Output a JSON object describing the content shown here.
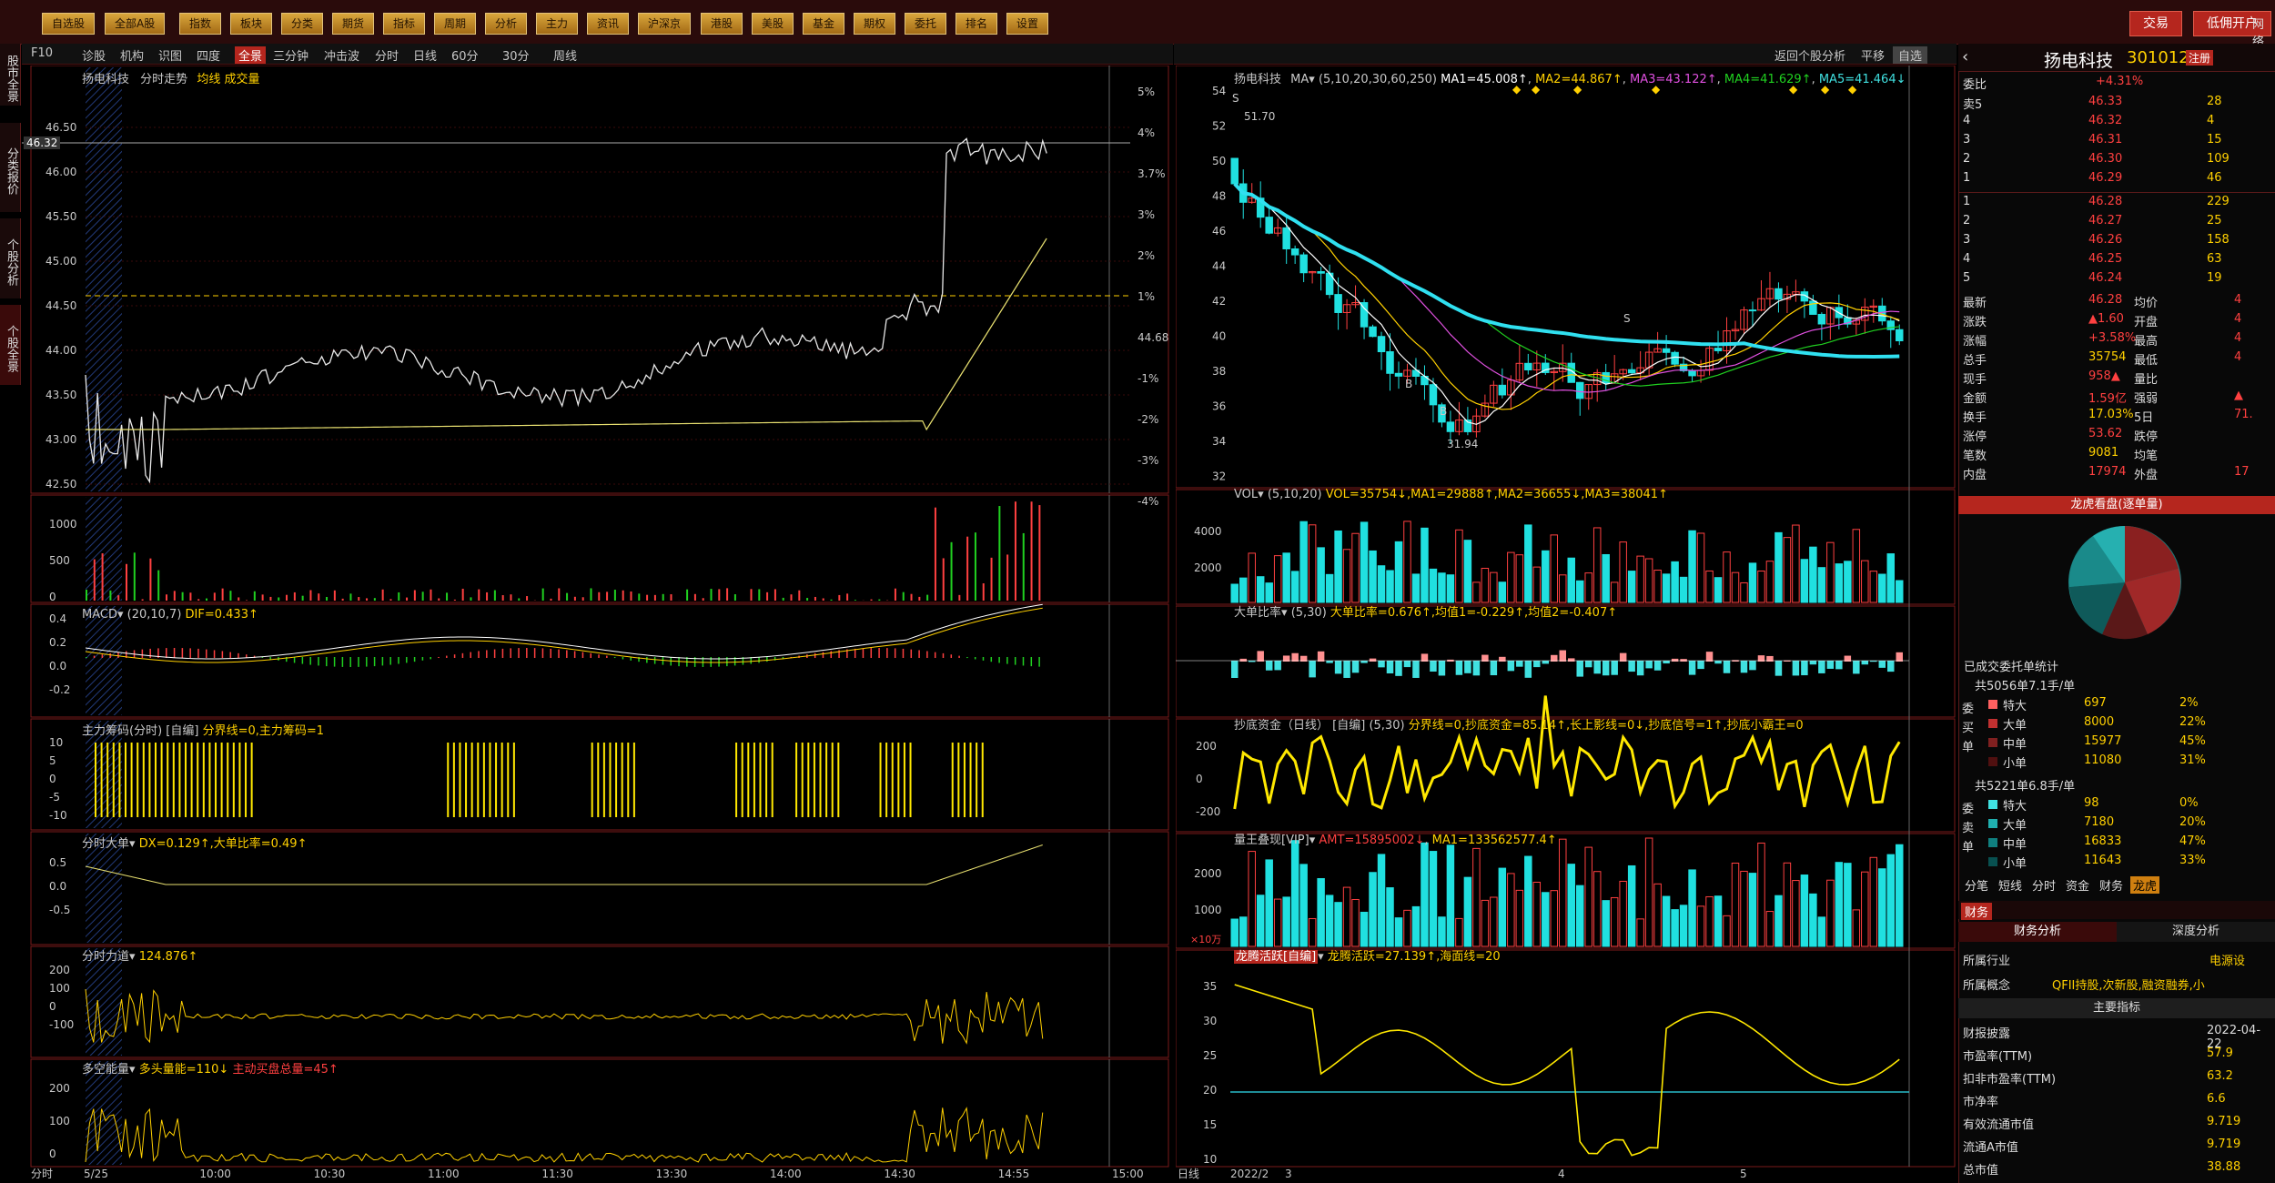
{
  "topbar": {
    "nav_buttons": [
      "自选股",
      "全部A股",
      "指数",
      "板块",
      "分类",
      "期货",
      "指标",
      "周期",
      "分析",
      "主力",
      "资讯",
      "沪深京",
      "港股",
      "美股",
      "基金",
      "期权",
      "委托",
      "排名",
      "设置"
    ],
    "trade_label": "交易",
    "open_account_label": "低佣开户",
    "network_label": "网络"
  },
  "sidetabs": [
    "股市全景",
    "分类报价",
    "个股分析",
    "个股全景"
  ],
  "left_toolbar": {
    "items": [
      "F10",
      "诊股",
      "机构",
      "识图",
      "四度",
      "全景",
      "三分钟",
      "冲击波",
      "分时",
      "日线",
      "60分",
      "30分",
      "周线"
    ],
    "active": "全景"
  },
  "mid_toolbar": {
    "back_label": "返回个股分析",
    "flat_label": "平移",
    "select_label": "自选"
  },
  "intraday": {
    "stock_name": "扬电科技",
    "mode": "分时走势",
    "legend": "均线 成交量",
    "y_ticks": [
      "46.50",
      "46.00",
      "45.50",
      "45.00",
      "44.50",
      "44.00",
      "43.50",
      "43.00",
      "42.50"
    ],
    "current_price": "46.32",
    "pct_ticks": [
      "5%",
      "4%",
      "3.7%",
      "3%",
      "2%",
      "1%",
      "44.68",
      "-1%",
      "-2%",
      "-3%",
      "-4%"
    ],
    "time_ticks": [
      "分时",
      "5/25",
      "10:00",
      "10:30",
      "11:00",
      "11:30",
      "13:30",
      "14:00",
      "14:30",
      "14:55",
      "15:00"
    ]
  },
  "subpanels": {
    "volume": {
      "y_ticks": [
        "1000",
        "500",
        "0"
      ]
    },
    "macd": {
      "title": "MACD",
      "params": "(20,10,7)",
      "value": "DIF=0.433↑",
      "y_ticks": [
        "0.4",
        "0.2",
        "0.0",
        "-0.2"
      ]
    },
    "main_chip": {
      "title": "主力筹码(分时)",
      "mode": "[自编]",
      "params": "分界线=0,主力筹码=1",
      "y_ticks": [
        "10",
        "5",
        "0",
        "-5",
        "-10"
      ]
    },
    "big_order": {
      "title": "分时大单",
      "value": "DX=0.129↑,大单比率=0.49↑",
      "y_ticks": [
        "0.5",
        "0.0",
        "-0.5"
      ]
    },
    "force": {
      "title": "分时力道",
      "value": "124.876↑",
      "y_ticks": [
        "200",
        "100",
        "0",
        "-100"
      ]
    },
    "multi_energy": {
      "title": "多空能量",
      "value1": "多头量能=110↓",
      "value2": "主动买盘总量=45↑",
      "y_ticks": [
        "200",
        "100",
        "0"
      ]
    }
  },
  "kline": {
    "stock_name": "扬电科技",
    "indicator": "MA",
    "params": "(5,10,20,30,60,250)",
    "ma1": "MA1=45.008↑",
    "ma2": "MA2=44.867↑",
    "ma3": "MA3=43.122↑",
    "ma4": "MA4=41.629↑",
    "ma5": "MA5=41.464↓",
    "y_ticks": [
      "54",
      "52",
      "50",
      "48",
      "46",
      "44",
      "42",
      "40",
      "38",
      "36",
      "34",
      "32"
    ],
    "high_label": "51.70",
    "low_label": "31.94",
    "signal_s": "S",
    "signal_b": "B",
    "date_ticks": [
      "日线",
      "2022/2",
      "3",
      "4",
      "5"
    ]
  },
  "kline_sub": {
    "vol": {
      "title": "VOL",
      "params": "(5,10,20)",
      "values": "VOL=35754↓,MA1=29888↑,MA2=36655↓,MA3=38041↑",
      "y_ticks": [
        "4000",
        "2000"
      ]
    },
    "big_ratio": {
      "title": "大单比率",
      "params": "(5,30)",
      "values": "大单比率=0.676↑,均值1=-0.229↑,均值2=-0.407↑"
    },
    "bottom_fund": {
      "title": "抄底资金（日线）",
      "mode": "[自编]",
      "params": "(5,30)",
      "values": "分界线=0,抄底资金=85.14↑,长上影线=0↓,抄底信号=1↑,抄底小霸王=0",
      "y_ticks": [
        "200",
        "0",
        "-200"
      ]
    },
    "volume_king": {
      "title": "量王叠现[VIP]",
      "values1": "AMT=15895002↓",
      "values2": "MA1=133562577.4↑",
      "y_ticks": [
        "2000",
        "1000"
      ],
      "unit": "×10万"
    },
    "dragon": {
      "title": "龙腾活跃[自编]",
      "values": "龙腾活跃=27.139↑,海面线=20",
      "y_ticks": [
        "35",
        "30",
        "25",
        "20",
        "15",
        "10"
      ]
    }
  },
  "right_panel": {
    "stock_name": "扬电科技",
    "code": "301012",
    "tag": "注册",
    "committee_ratio_label": "委比",
    "committee_ratio_value": "+4.31%",
    "asks": [
      {
        "label": "卖5",
        "price": "46.33",
        "vol": "28"
      },
      {
        "label": "4",
        "price": "46.32",
        "vol": "4"
      },
      {
        "label": "3",
        "price": "46.31",
        "vol": "15"
      },
      {
        "label": "2",
        "price": "46.30",
        "vol": "109"
      },
      {
        "label": "1",
        "price": "46.29",
        "vol": "46"
      }
    ],
    "bids": [
      {
        "label": "1",
        "price": "46.28",
        "vol": "229"
      },
      {
        "label": "2",
        "price": "46.27",
        "vol": "25"
      },
      {
        "label": "3",
        "price": "46.26",
        "vol": "158"
      },
      {
        "label": "4",
        "price": "46.25",
        "vol": "63"
      },
      {
        "label": "5",
        "price": "46.24",
        "vol": "19"
      }
    ],
    "stats": [
      {
        "k1": "最新",
        "v1": "46.28",
        "k2": "均价",
        "v2": "4"
      },
      {
        "k1": "涨跌",
        "v1": "▲1.60",
        "k2": "开盘",
        "v2": "4"
      },
      {
        "k1": "涨幅",
        "v1": "+3.58%",
        "k2": "最高",
        "v2": "4"
      },
      {
        "k1": "总手",
        "v1": "35754",
        "k2": "最低",
        "v2": "4"
      },
      {
        "k1": "现手",
        "v1": "958▲",
        "k2": "量比",
        "v2": ""
      },
      {
        "k1": "金额",
        "v1": "1.59亿",
        "k2": "强弱",
        "v2": "▲"
      },
      {
        "k1": "换手",
        "v1": "17.03%",
        "k2": "5日",
        "v2": "71."
      },
      {
        "k1": "涨停",
        "v1": "53.62",
        "k2": "跌停",
        "v2": ""
      },
      {
        "k1": "笔数",
        "v1": "9081",
        "k2": "均笔",
        "v2": ""
      },
      {
        "k1": "内盘",
        "v1": "17974",
        "k2": "外盘",
        "v2": "17"
      }
    ],
    "pie_title": "龙虎看盘(逐单量)",
    "deal_title": "已成交委托单统计",
    "buy_total": "共5056单7.1手/单",
    "buy_rows": [
      {
        "cat": "特大",
        "v": "697",
        "p": "2%"
      },
      {
        "cat": "大单",
        "v": "8000",
        "p": "22%"
      },
      {
        "cat": "中单",
        "v": "15977",
        "p": "45%"
      },
      {
        "cat": "小单",
        "v": "11080",
        "p": "31%"
      }
    ],
    "sell_total": "共5221单6.8手/单",
    "sell_rows": [
      {
        "cat": "特大",
        "v": "98",
        "p": "0%"
      },
      {
        "cat": "大单",
        "v": "7180",
        "p": "20%"
      },
      {
        "cat": "中单",
        "v": "16833",
        "p": "47%"
      },
      {
        "cat": "小单",
        "v": "11643",
        "p": "33%"
      }
    ],
    "side_labels_buy": [
      "委",
      "买",
      "单"
    ],
    "side_labels_sell": [
      "委",
      "卖",
      "单"
    ],
    "tabs": [
      "分笔",
      "短线",
      "分时",
      "资金",
      "财务",
      "龙虎"
    ],
    "active_tab": "龙虎",
    "fin_tab": "财务",
    "fin_header_left": "财务分析",
    "fin_header_right": "深度分析",
    "industry_label": "所属行业",
    "industry_value": "电源设",
    "concept_label": "所属概念",
    "concept_value": "QFII持股,次新股,融资融券,小",
    "indicator_header": "主要指标",
    "fin_rows": [
      {
        "k": "财报披露",
        "v": "2022-04-22"
      },
      {
        "k": "市盈率(TTM)",
        "v": "57.9"
      },
      {
        "k": "扣非市盈率(TTM)",
        "v": "63.2"
      },
      {
        "k": "市净率",
        "v": "6.6"
      },
      {
        "k": "有效流通市值",
        "v": "9.719"
      },
      {
        "k": "流通A市值",
        "v": "9.719"
      },
      {
        "k": "总市值",
        "v": "38.88"
      }
    ]
  }
}
